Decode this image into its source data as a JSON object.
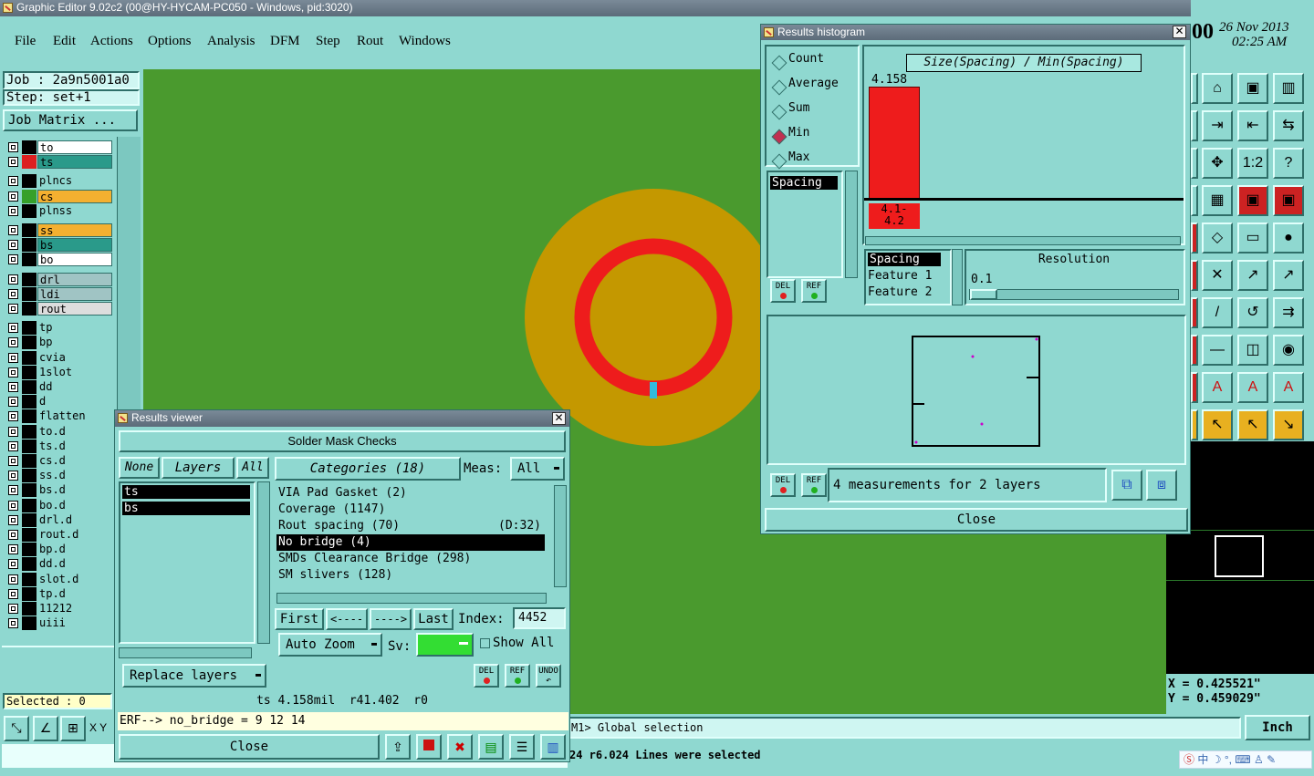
{
  "window": {
    "title": "Graphic Editor 9.02c2 (00@HY-HYCAM-PC050 - Windows, pid:3020)"
  },
  "clock": {
    "time_prefix": "00",
    "date": "26 Nov 2013",
    "time": "02:25 AM"
  },
  "menu": {
    "items": [
      "File",
      "Edit",
      "Actions",
      "Options",
      "Analysis",
      "DFM",
      "Step",
      "Rout",
      "Windows"
    ]
  },
  "job": {
    "job_label": "Job : 2a9n5001a0",
    "step_label": "Step: set+1",
    "matrix_button": "Job Matrix ..."
  },
  "layers": [
    {
      "name": "to",
      "bg": "#ffffff",
      "sw": "#000000"
    },
    {
      "name": "ts",
      "bg": "#2a9a8a",
      "sw": "#dd2020"
    },
    {
      "name": "plncs",
      "bg": "#8fd8d0",
      "sw": "#000000"
    },
    {
      "name": "cs",
      "bg": "#f4b030",
      "sw": "#36a02a"
    },
    {
      "name": "plnss",
      "bg": "#8fd8d0",
      "sw": "#000000"
    },
    {
      "name": "ss",
      "bg": "#f4b030",
      "sw": "#000000"
    },
    {
      "name": "bs",
      "bg": "#2a9a8a",
      "sw": "#000000"
    },
    {
      "name": "bo",
      "bg": "#ffffff",
      "sw": "#000000"
    },
    {
      "name": "drl",
      "bg": "#a0c4c4",
      "sw": "#000000"
    },
    {
      "name": "ldi",
      "bg": "#a0c4c4",
      "sw": "#000000"
    },
    {
      "name": "rout",
      "bg": "#dddddd",
      "sw": "#000000"
    },
    {
      "name": "tp",
      "bg": "#8fd8d0",
      "sw": "#000000"
    },
    {
      "name": "bp",
      "bg": "#8fd8d0",
      "sw": "#000000"
    },
    {
      "name": "cvia",
      "bg": "#8fd8d0",
      "sw": "#000000"
    },
    {
      "name": "1slot",
      "bg": "#8fd8d0",
      "sw": "#000000"
    },
    {
      "name": "dd",
      "bg": "#8fd8d0",
      "sw": "#000000"
    },
    {
      "name": "d",
      "bg": "#8fd8d0",
      "sw": "#000000"
    },
    {
      "name": "flatten",
      "bg": "#8fd8d0",
      "sw": "#000000"
    },
    {
      "name": "to.d",
      "bg": "#8fd8d0",
      "sw": "#000000"
    },
    {
      "name": "ts.d",
      "bg": "#8fd8d0",
      "sw": "#000000"
    },
    {
      "name": "cs.d",
      "bg": "#8fd8d0",
      "sw": "#000000"
    },
    {
      "name": "ss.d",
      "bg": "#8fd8d0",
      "sw": "#000000"
    },
    {
      "name": "bs.d",
      "bg": "#8fd8d0",
      "sw": "#000000"
    },
    {
      "name": "bo.d",
      "bg": "#8fd8d0",
      "sw": "#000000"
    },
    {
      "name": "drl.d",
      "bg": "#8fd8d0",
      "sw": "#000000"
    },
    {
      "name": "rout.d",
      "bg": "#8fd8d0",
      "sw": "#000000"
    },
    {
      "name": "bp.d",
      "bg": "#8fd8d0",
      "sw": "#000000"
    },
    {
      "name": "dd.d",
      "bg": "#8fd8d0",
      "sw": "#000000"
    },
    {
      "name": "slot.d",
      "bg": "#8fd8d0",
      "sw": "#000000"
    },
    {
      "name": "tp.d",
      "bg": "#8fd8d0",
      "sw": "#000000"
    },
    {
      "name": "11212",
      "bg": "#8fd8d0",
      "sw": "#000000"
    },
    {
      "name": "uiii",
      "bg": "#8fd8d0",
      "sw": "#000000"
    }
  ],
  "status": {
    "selected": "Selected : 0",
    "xy_label": "X Y",
    "message": "M1> Global selection",
    "lines_selected": "24 r6.024 Lines were selected",
    "units": "Inch",
    "coord_x": "X = 0.425521\"",
    "coord_y": "Y = 0.459029\""
  },
  "results_viewer": {
    "title": "Results viewer",
    "heading": "Solder Mask Checks",
    "none_btn": "None",
    "layers_btn": "Layers",
    "all_btn": "All",
    "categories_btn": "Categories (18)",
    "meas_label": "Meas:",
    "meas_value": "All",
    "layers": [
      "ts",
      "bs"
    ],
    "categories": [
      {
        "name": "VIA Pad Gasket (2)",
        "extra": ""
      },
      {
        "name": "Coverage (1147)",
        "extra": ""
      },
      {
        "name": "Rout spacing (70)",
        "extra": "(D:32)"
      },
      {
        "name": "No bridge (4)",
        "extra": ""
      },
      {
        "name": "SMDs Clearance Bridge (298)",
        "extra": ""
      },
      {
        "name": "SM slivers (128)",
        "extra": ""
      }
    ],
    "first": "First",
    "prev": "<----",
    "next": "---->",
    "last": "Last",
    "index_label": "Index:",
    "index_value": "4452",
    "auto_zoom": "Auto Zoom",
    "sv_label": "Sv:",
    "show_all": "Show All",
    "replace_layers": "Replace layers",
    "del": "DEL",
    "ref": "REF",
    "undo": "UNDO",
    "info_line": "ts 4.158mil  r41.402  r0",
    "erf_line": "ERF--> no_bridge = 9 12 14",
    "close": "Close"
  },
  "histogram": {
    "title": "Results histogram",
    "modes": [
      "Count",
      "Average",
      "Sum",
      "Min",
      "Max"
    ],
    "selected_mode": "Min",
    "list": [
      "Spacing"
    ],
    "chart_title": "Size(Spacing) / Min(Spacing)",
    "bar_value": "4.158",
    "bin_label": "4.1-\n4.2",
    "attributes": [
      "Spacing",
      "Feature 1",
      "Feature 2"
    ],
    "resolution_label": "Resolution",
    "resolution_value": "0.1",
    "measurements": "4 measurements for 2 layers",
    "del": "DEL",
    "ref": "REF",
    "close": "Close"
  },
  "colors": {
    "canvas": "#4a9a2e",
    "pad": "#c49800",
    "ring": "#ee1c1c",
    "panel": "#8fd8d0"
  }
}
